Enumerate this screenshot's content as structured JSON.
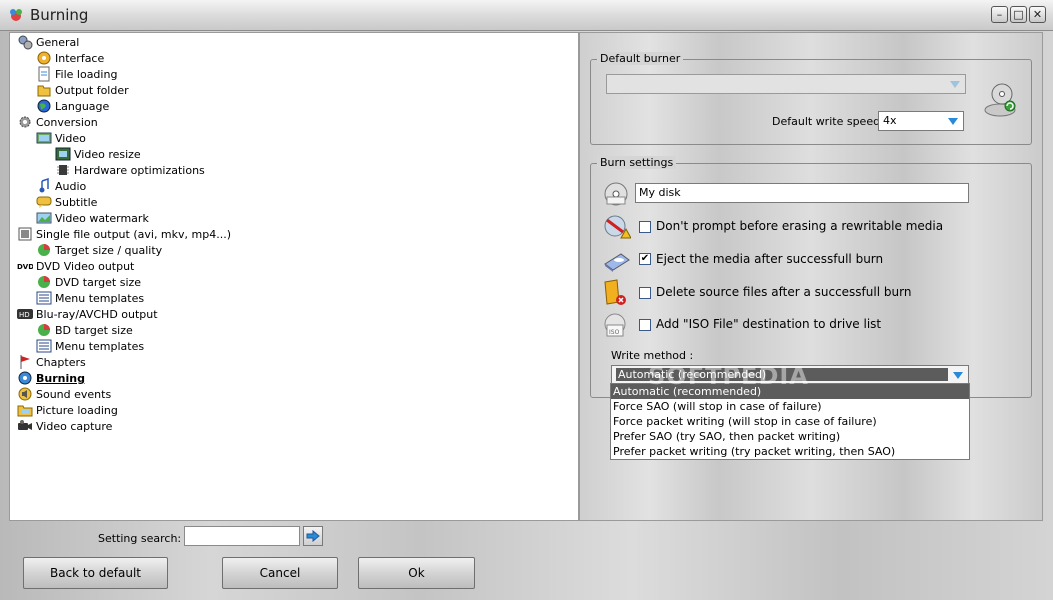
{
  "window": {
    "title": "Burning",
    "controls": {
      "minimize": "–",
      "maximize": "□",
      "close": "✕"
    }
  },
  "tree": [
    {
      "label": "General",
      "icon": "general-settings-icon",
      "level": 0
    },
    {
      "label": "Interface",
      "icon": "interface-icon",
      "level": 1
    },
    {
      "label": "File loading",
      "icon": "file-loading-icon",
      "level": 1
    },
    {
      "label": "Output folder",
      "icon": "folder-icon",
      "level": 1
    },
    {
      "label": "Language",
      "icon": "globe-icon",
      "level": 1
    },
    {
      "label": "Conversion",
      "icon": "gear-icon",
      "level": 0
    },
    {
      "label": "Video",
      "icon": "video-icon",
      "level": 1
    },
    {
      "label": "Video resize",
      "icon": "video-resize-icon",
      "level": 2
    },
    {
      "label": "Hardware optimizations",
      "icon": "hardware-chip-icon",
      "level": 2
    },
    {
      "label": "Audio",
      "icon": "music-note-icon",
      "level": 1
    },
    {
      "label": "Subtitle",
      "icon": "speech-bubble-icon",
      "level": 1
    },
    {
      "label": "Video watermark",
      "icon": "watermark-image-icon",
      "level": 1
    },
    {
      "label": "Single file output (avi, mkv, mp4...)",
      "icon": "film-file-icon",
      "level": 0
    },
    {
      "label": "Target size / quality",
      "icon": "pie-chart-icon",
      "level": 1
    },
    {
      "label": "DVD Video output",
      "icon": "dvd-logo-icon",
      "level": 0
    },
    {
      "label": "DVD target size",
      "icon": "pie-chart-icon",
      "level": 1
    },
    {
      "label": "Menu templates",
      "icon": "menu-template-icon",
      "level": 1
    },
    {
      "label": "Blu-ray/AVCHD output",
      "icon": "hd-badge-icon",
      "level": 0
    },
    {
      "label": "BD target size",
      "icon": "pie-chart-icon",
      "level": 1
    },
    {
      "label": "Menu templates",
      "icon": "menu-template-icon",
      "level": 1
    },
    {
      "label": "Chapters",
      "icon": "flag-icon",
      "level": 0
    },
    {
      "label": "Burning",
      "icon": "disc-burn-icon",
      "level": 0,
      "selected": true
    },
    {
      "label": "Sound events",
      "icon": "sound-events-icon",
      "level": 0
    },
    {
      "label": "Picture loading",
      "icon": "picture-folder-icon",
      "level": 0
    },
    {
      "label": "Video capture",
      "icon": "camcorder-icon",
      "level": 0
    }
  ],
  "default_burner": {
    "group_title": "Default burner",
    "burner_value": "",
    "write_speed_label": "Default write speed :",
    "write_speed_value": "4x"
  },
  "burn_settings": {
    "group_title": "Burn settings",
    "disc_name": "My disk",
    "options": [
      {
        "label": "Don't prompt before erasing a rewritable media",
        "checked": false,
        "icon": "erase-warning-icon"
      },
      {
        "label": "Eject the media after successfull burn",
        "checked": true,
        "icon": "eject-disc-icon"
      },
      {
        "label": "Delete source files after a successfull burn",
        "checked": false,
        "icon": "delete-files-icon"
      },
      {
        "label": "Add \"ISO File\" destination to drive list",
        "checked": false,
        "icon": "iso-file-icon"
      }
    ],
    "write_method_label": "Write method :",
    "write_method_value": "Automatic (recommended)",
    "write_method_options": [
      "Automatic (recommended)",
      "Force SAO (will stop in case of failure)",
      "Force packet writing (will stop in case of failure)",
      "Prefer SAO (try SAO, then packet writing)",
      "Prefer packet writing (try packet writing, then SAO)"
    ]
  },
  "footer": {
    "search_label": "Setting search:",
    "search_value": "",
    "back_to_default": "Back to default",
    "cancel": "Cancel",
    "ok": "Ok"
  },
  "watermark_text": "SOFTPEDIA",
  "colors": {
    "accent_blue": "#2a8ad8",
    "selection_gray": "#5c5c5c"
  }
}
